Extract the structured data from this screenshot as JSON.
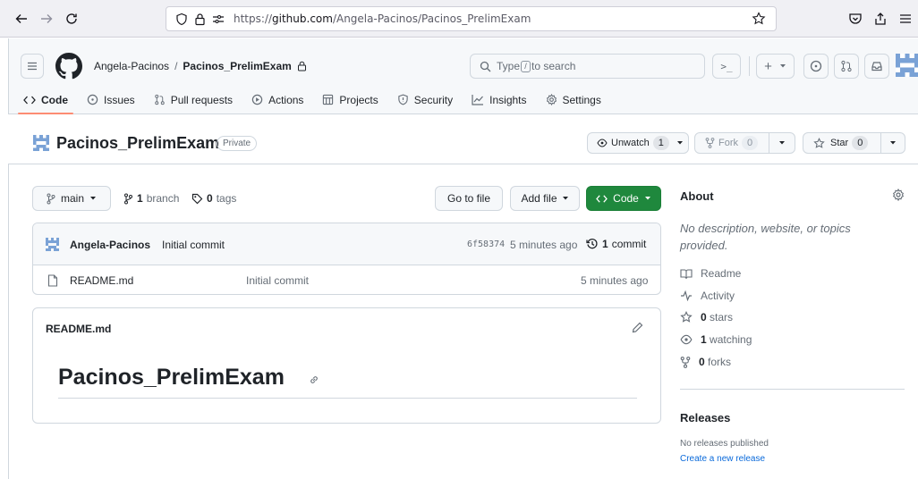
{
  "browser": {
    "url_prefix": "https://",
    "url_domain": "github.com",
    "url_path": "/Angela-Pacinos/Pacinos_PrelimExam"
  },
  "header": {
    "owner": "Angela-Pacinos",
    "separator": "/",
    "repo": "Pacinos_PrelimExam",
    "search_type": "Type",
    "search_key": "/",
    "search_rest": "to search",
    "terminal_label": ">_",
    "plus_label": "+"
  },
  "tabs": [
    {
      "label": "Code",
      "icon": "code-icon"
    },
    {
      "label": "Issues",
      "icon": "issue-icon"
    },
    {
      "label": "Pull requests",
      "icon": "pull-request-icon"
    },
    {
      "label": "Actions",
      "icon": "play-icon"
    },
    {
      "label": "Projects",
      "icon": "table-icon"
    },
    {
      "label": "Security",
      "icon": "shield-icon"
    },
    {
      "label": "Insights",
      "icon": "graph-icon"
    },
    {
      "label": "Settings",
      "icon": "gear-icon"
    }
  ],
  "repo": {
    "name": "Pacinos_PrelimExam",
    "visibility": "Private",
    "unwatch_label": "Unwatch",
    "watch_count": "1",
    "fork_label": "Fork",
    "fork_count": "0",
    "star_label": "Star",
    "star_count": "0"
  },
  "toolbar": {
    "branch": "main",
    "branch_count": "1",
    "branch_word": "branch",
    "tag_count": "0",
    "tag_word": "tags",
    "go_to_file": "Go to file",
    "add_file": "Add file",
    "code_button": "Code"
  },
  "commit": {
    "author": "Angela-Pacinos",
    "message": "Initial commit",
    "hash": "6f58374",
    "time": "5 minutes ago",
    "count": "1",
    "count_word": "commit"
  },
  "files": [
    {
      "name": "README.md",
      "message": "Initial commit",
      "time": "5 minutes ago"
    }
  ],
  "readme": {
    "filename": "README.md",
    "heading": "Pacinos_PrelimExam"
  },
  "about": {
    "title": "About",
    "description": "No description, website, or topics provided.",
    "readme": "Readme",
    "activity": "Activity",
    "stars_count": "0",
    "stars_word": "stars",
    "watching_count": "1",
    "watching_word": "watching",
    "forks_count": "0",
    "forks_word": "forks"
  },
  "releases": {
    "title": "Releases",
    "none_text": "No releases published",
    "create_link": "Create a new release"
  },
  "colors": {
    "accent_green": "#1f883d",
    "link_blue": "#0969da",
    "tab_underline": "#fd8c73",
    "identicon": "#7aa2d6"
  }
}
